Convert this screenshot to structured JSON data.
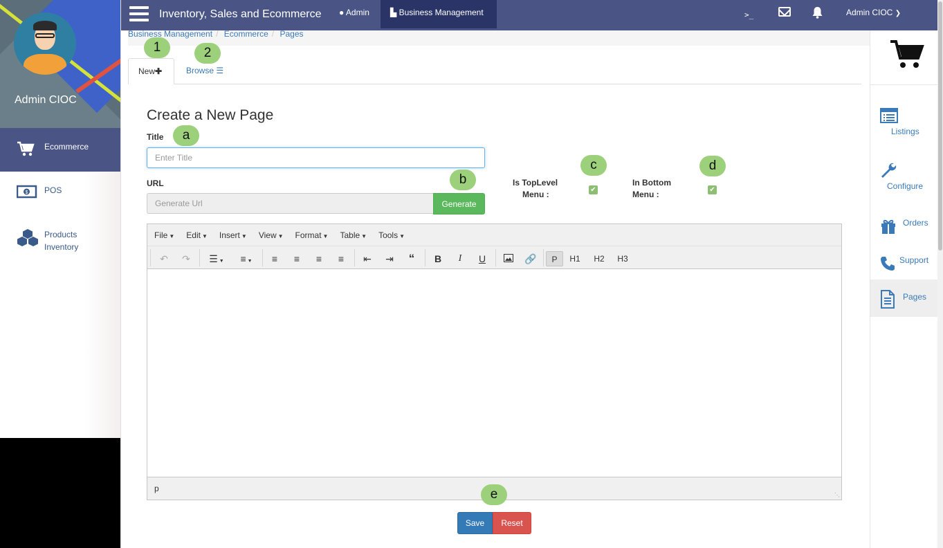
{
  "app": {
    "title": "Inventory, Sales and Ecommerce",
    "nav_admin": "Admin",
    "nav_business": "Business Management",
    "terminal_glyph": ">_",
    "user_menu": "Admin CIOC"
  },
  "profile": {
    "name": "Admin CIOC"
  },
  "left_sidebar": {
    "items": [
      {
        "label": "Ecommerce",
        "icon": "cart-icon",
        "active": true
      },
      {
        "label": "POS",
        "icon": "money-icon",
        "active": false
      },
      {
        "label": "Products Inventory",
        "icon": "cubes-icon",
        "active": false
      }
    ]
  },
  "breadcrumb": [
    "Business Management",
    "Ecommerce",
    "Pages"
  ],
  "tabs": [
    {
      "label": "New",
      "icon": "plus-icon"
    },
    {
      "label": "Browse",
      "icon": "list-icon"
    }
  ],
  "annotations": {
    "tab_new": "1",
    "tab_browse": "2",
    "title": "a",
    "generate": "b",
    "toplevel": "c",
    "bottom": "d",
    "save": "e"
  },
  "form": {
    "heading": "Create a New Page",
    "title_label": "Title",
    "title_placeholder": "Enter Title",
    "url_label": "URL",
    "url_placeholder": "Generate Url",
    "generate_label": "Generate",
    "toplevel_label_1": "Is TopLevel",
    "toplevel_label_2": "Menu :",
    "toplevel_checked": true,
    "bottom_label_1": "In Bottom",
    "bottom_label_2": "Menu :",
    "bottom_checked": true,
    "save_label": "Save",
    "reset_label": "Reset"
  },
  "editor": {
    "menus": [
      "File",
      "Edit",
      "Insert",
      "View",
      "Format",
      "Table",
      "Tools"
    ],
    "block_formats": [
      "P",
      "H1",
      "H2",
      "H3"
    ],
    "selected_block": "P",
    "status_path": "p"
  },
  "right_sidebar": {
    "items": [
      {
        "label": "Listings",
        "icon": "list-alt-icon"
      },
      {
        "label": "Configure",
        "icon": "wrench-icon"
      },
      {
        "label": "Orders",
        "icon": "gift-icon"
      },
      {
        "label": "Support",
        "icon": "phone-icon"
      },
      {
        "label": "Pages",
        "icon": "file-icon",
        "active": true
      }
    ]
  },
  "colors": {
    "topbar": "#4a5585",
    "accent_blue": "#337ab7",
    "success": "#5cb85c",
    "danger": "#d9534f",
    "badge": "#9cd07a"
  }
}
